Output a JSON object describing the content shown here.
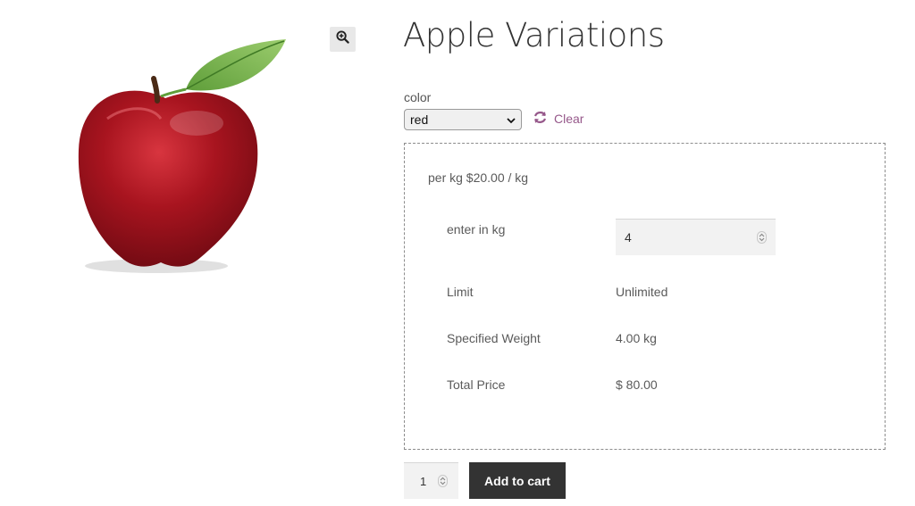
{
  "product": {
    "title": "Apple Variations",
    "image_alt": "red apple with leaf"
  },
  "icons": {
    "zoom": "zoom-in-magnifier-icon",
    "clear": "refresh-arrows-icon",
    "select_arrow": "chevron-down-icon",
    "spinner": "up-down-spinner-icon"
  },
  "colors": {
    "accent": "#96588a",
    "button_bg": "#333333",
    "box_border": "#8c8c8c"
  },
  "variation": {
    "attribute_label": "color",
    "selected_value": "red",
    "clear_label": "Clear"
  },
  "measurement": {
    "unit_price": "per kg $20.00 / kg",
    "rows": [
      {
        "label": "enter in kg",
        "value": "4"
      },
      {
        "label": "Limit",
        "value": "Unlimited"
      },
      {
        "label": "Specified Weight",
        "value": "4.00 kg"
      },
      {
        "label": "Total Price",
        "value": "$ 80.00"
      }
    ]
  },
  "cart": {
    "quantity": "1",
    "add_label": "Add to cart"
  }
}
